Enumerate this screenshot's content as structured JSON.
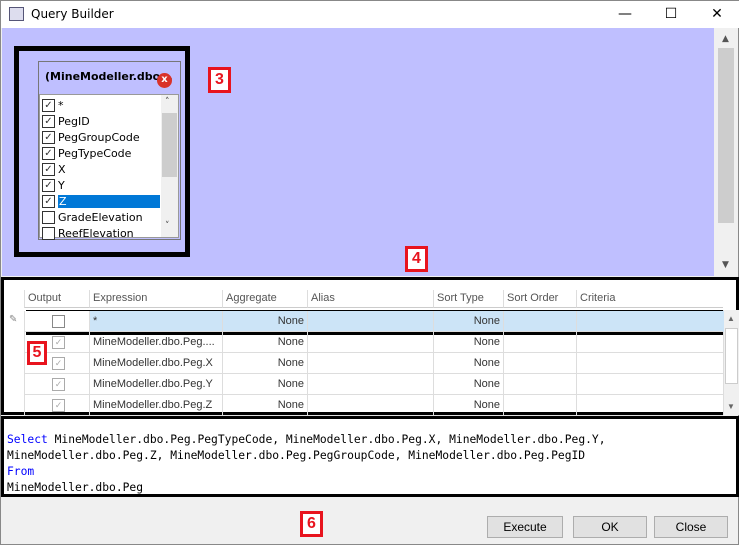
{
  "window": {
    "title": "Query Builder",
    "minimize": "—",
    "maximize": "☐",
    "close": "✕"
  },
  "diagram": {
    "table_title": "(MineModeller.dbo...",
    "columns": [
      {
        "name": "*",
        "checked": true
      },
      {
        "name": "PegID",
        "checked": true
      },
      {
        "name": "PegGroupCode",
        "checked": true
      },
      {
        "name": "PegTypeCode",
        "checked": true
      },
      {
        "name": "X",
        "checked": true
      },
      {
        "name": "Y",
        "checked": true
      },
      {
        "name": "Z",
        "checked": true,
        "selected": true
      },
      {
        "name": "GradeElevation",
        "checked": false
      },
      {
        "name": "ReefElevation",
        "checked": false
      }
    ],
    "selection_color": "#0078d7",
    "background_color": "#bfbfff"
  },
  "annotations": {
    "a3": "3",
    "a4": "4",
    "a5": "5",
    "a6": "6"
  },
  "grid": {
    "headers": [
      "Output",
      "Expression",
      "Aggregate",
      "Alias",
      "Sort Type",
      "Sort Order",
      "Criteria"
    ],
    "rows": [
      {
        "output": false,
        "expression": "*",
        "aggregate": "None",
        "alias": "",
        "sort_type": "None",
        "sort_order": "",
        "criteria": ""
      },
      {
        "output": true,
        "expression": "MineModeller.dbo.Peg....",
        "aggregate": "None",
        "alias": "",
        "sort_type": "None",
        "sort_order": "",
        "criteria": ""
      },
      {
        "output": true,
        "expression": "MineModeller.dbo.Peg.X",
        "aggregate": "None",
        "alias": "",
        "sort_type": "None",
        "sort_order": "",
        "criteria": ""
      },
      {
        "output": true,
        "expression": "MineModeller.dbo.Peg.Y",
        "aggregate": "None",
        "alias": "",
        "sort_type": "None",
        "sort_order": "",
        "criteria": ""
      },
      {
        "output": true,
        "expression": "MineModeller.dbo.Peg.Z",
        "aggregate": "None",
        "alias": "",
        "sort_type": "None",
        "sort_order": "",
        "criteria": ""
      }
    ]
  },
  "sql": {
    "select_kw": "Select",
    "select_body": " MineModeller.dbo.Peg.PegTypeCode, MineModeller.dbo.Peg.X, MineModeller.dbo.Peg.Y,\nMineModeller.dbo.Peg.Z, MineModeller.dbo.Peg.PegGroupCode, MineModeller.dbo.Peg.PegID",
    "from_kw": "From",
    "from_body": "MineModeller.dbo.Peg"
  },
  "buttons": {
    "execute": "Execute",
    "ok": "OK",
    "close": "Close"
  }
}
